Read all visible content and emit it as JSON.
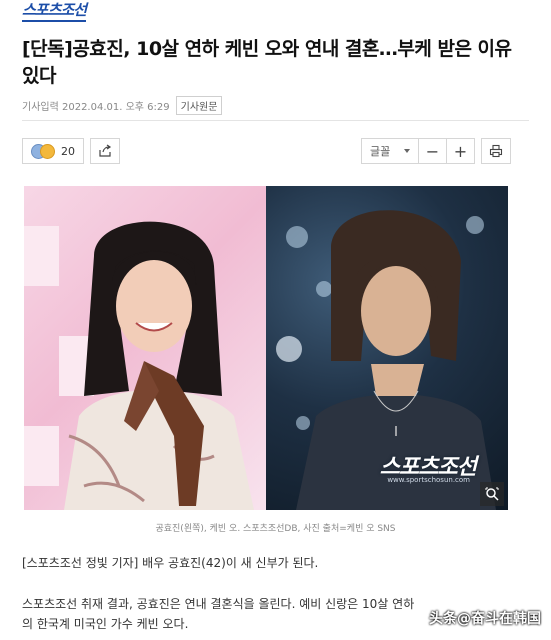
{
  "brand": {
    "logo_text": "스포츠조선"
  },
  "article": {
    "headline": "[단독]공효진, 10살 연하 케빈 오와 연내 결혼…부케 받은 이유 있다",
    "meta_label": "기사입력 2022.04.01. 오후 6:29",
    "original_button": "기사원문"
  },
  "toolbar": {
    "reaction_count": "20",
    "font_label": "글꼴",
    "zoom_out": "−",
    "zoom_in": "+"
  },
  "photo": {
    "watermark": "스포츠조선",
    "watermark_url": "www.sportschosun.com",
    "caption": "공효진(왼쪽), 케빈 오. 스포츠조선DB, 사진 출처=케빈 오 SNS"
  },
  "body": {
    "p1": "[스포츠조선 정빛 기자] 배우 공효진(42)이 새 신부가 된다.",
    "p2_line1": "스포츠조선 취재 결과, 공효진은 연내 결혼식을 올린다. 예비 신랑은 10살 연하",
    "p2_line2": "의 한국계 미국인 가수 케빈 오다."
  },
  "overlay": {
    "source_mark": "头条@奋斗在韩国"
  },
  "icons": [
    "emoji-reaction-icon",
    "share-icon",
    "chevron-down-icon",
    "print-icon",
    "magnify-icon"
  ]
}
